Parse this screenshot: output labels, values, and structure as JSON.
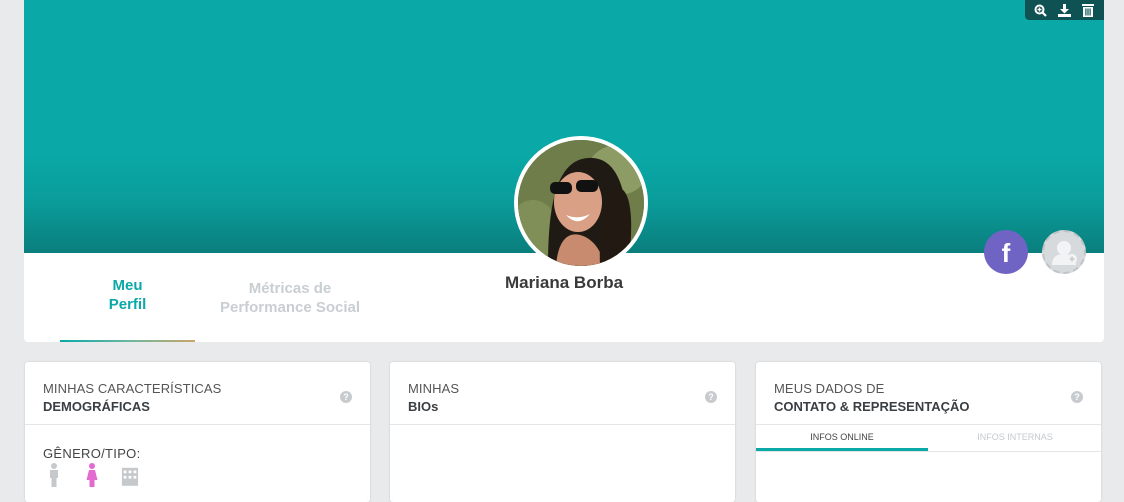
{
  "profile": {
    "name": "Mariana Borba"
  },
  "toolbar": {
    "icons": [
      "zoom-icon",
      "download-icon",
      "delete-icon"
    ]
  },
  "tabs": [
    {
      "label_line1": "Meu",
      "label_line2": "Perfil",
      "active": true
    },
    {
      "label_line1": "Métricas de",
      "label_line2": "Performance Social",
      "active": false
    }
  ],
  "social": {
    "facebook_glyph": "f"
  },
  "panels": [
    {
      "title_line1": "MINHAS CARACTERÍSTICAS",
      "title_line2": "DEMOGRÁFICAS",
      "help": "?",
      "gender_label": "GÊNERO/TIPO:"
    },
    {
      "title_line1": "MINHAS",
      "title_line2": "BIOs",
      "help": "?"
    },
    {
      "title_line1": "MEUS DADOS DE",
      "title_line2": "CONTATO & REPRESENTAÇÃO",
      "help": "?",
      "subtabs": [
        "INFOS ONLINE",
        "INFOS INTERNAS"
      ]
    }
  ],
  "colors": {
    "accent": "#0aa9a7",
    "facebook": "#6f63c4",
    "female_icon": "#e46ad0",
    "inactive": "#c9ced2"
  }
}
